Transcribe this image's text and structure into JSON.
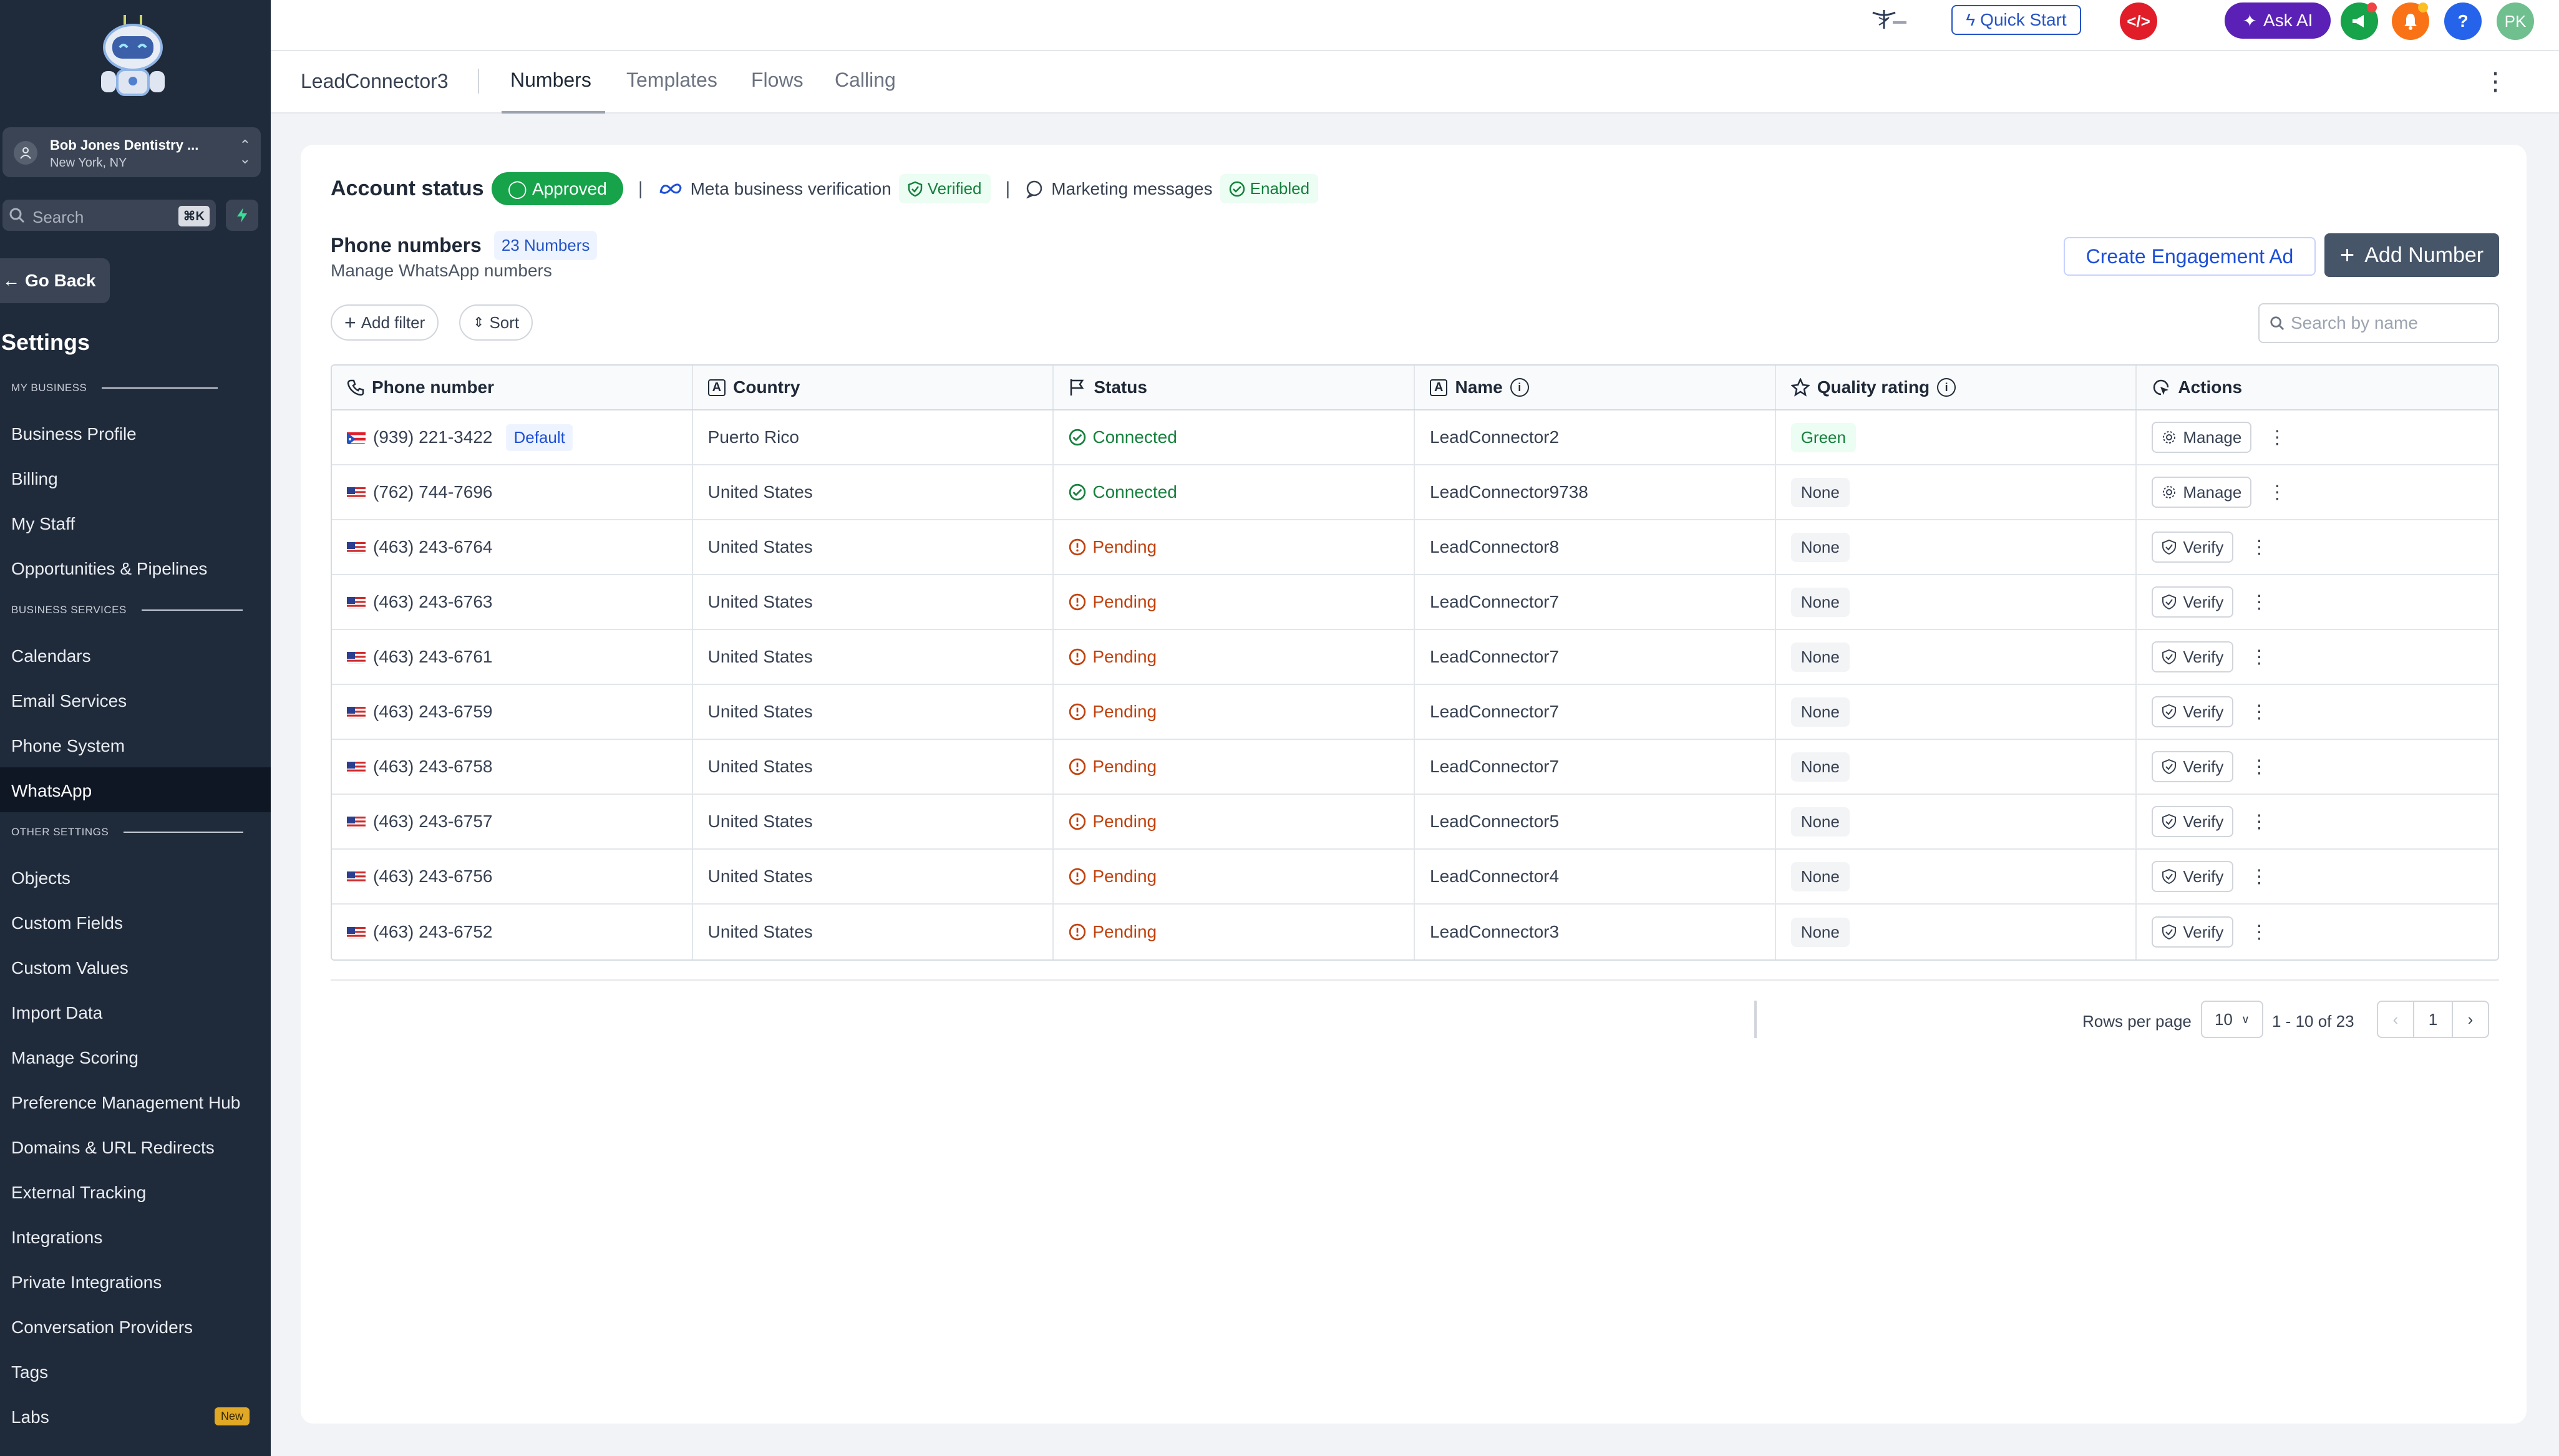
{
  "sidebar": {
    "account": {
      "name": "Bob Jones Dentistry ...",
      "location": "New York, NY"
    },
    "search": {
      "placeholder": "Search",
      "shortcut": "⌘K"
    },
    "go_back": "Go Back",
    "title": "Settings",
    "sections": {
      "my_business": "MY BUSINESS",
      "business_services": "BUSINESS SERVICES",
      "other_settings": "OTHER SETTINGS"
    },
    "items": {
      "business_profile": "Business Profile",
      "billing": "Billing",
      "my_staff": "My Staff",
      "opportunities": "Opportunities & Pipelines",
      "calendars": "Calendars",
      "email_services": "Email Services",
      "phone_system": "Phone System",
      "whatsapp": "WhatsApp",
      "objects": "Objects",
      "custom_fields": "Custom Fields",
      "custom_values": "Custom Values",
      "import_data": "Import Data",
      "manage_scoring": "Manage Scoring",
      "preference_hub": "Preference Management Hub",
      "domains": "Domains & URL Redirects",
      "external_tracking": "External Tracking",
      "integrations": "Integrations",
      "private_integrations": "Private Integrations",
      "conversation_providers": "Conversation Providers",
      "tags": "Tags",
      "labs": "Labs"
    },
    "labs_badge": "New"
  },
  "topbar": {
    "quick_start": "Quick Start",
    "ask_ai": "Ask AI",
    "help": "?",
    "avatar_initials": "PK"
  },
  "tabs": {
    "brand": "LeadConnector3",
    "items": [
      "Numbers",
      "Templates",
      "Flows",
      "Calling"
    ]
  },
  "status": {
    "account_status_label": "Account status",
    "account_status": "Approved",
    "meta_label": "Meta business verification",
    "meta_status": "Verified",
    "marketing_label": "Marketing messages",
    "marketing_status": "Enabled"
  },
  "phone_numbers": {
    "title": "Phone numbers",
    "count": "23 Numbers",
    "subtitle": "Manage WhatsApp numbers",
    "create_ad": "Create Engagement Ad",
    "add_number": "Add Number",
    "add_filter": "Add filter",
    "sort": "Sort",
    "search_placeholder": "Search by name"
  },
  "table": {
    "columns": [
      "Phone number",
      "Country",
      "Status",
      "Name",
      "Quality rating",
      "Actions"
    ],
    "default_label": "Default",
    "rows": [
      {
        "phone": "(939) 221-3422",
        "country": "Puerto Rico",
        "status": "Connected",
        "name": "LeadConnector2",
        "quality": "Green",
        "action": "Manage"
      },
      {
        "phone": "(762) 744-7696",
        "country": "United States",
        "status": "Connected",
        "name": "LeadConnector9738",
        "quality": "None",
        "action": "Manage"
      },
      {
        "phone": "(463) 243-6764",
        "country": "United States",
        "status": "Pending",
        "name": "LeadConnector8",
        "quality": "None",
        "action": "Verify"
      },
      {
        "phone": "(463) 243-6763",
        "country": "United States",
        "status": "Pending",
        "name": "LeadConnector7",
        "quality": "None",
        "action": "Verify"
      },
      {
        "phone": "(463) 243-6761",
        "country": "United States",
        "status": "Pending",
        "name": "LeadConnector7",
        "quality": "None",
        "action": "Verify"
      },
      {
        "phone": "(463) 243-6759",
        "country": "United States",
        "status": "Pending",
        "name": "LeadConnector7",
        "quality": "None",
        "action": "Verify"
      },
      {
        "phone": "(463) 243-6758",
        "country": "United States",
        "status": "Pending",
        "name": "LeadConnector7",
        "quality": "None",
        "action": "Verify"
      },
      {
        "phone": "(463) 243-6757",
        "country": "United States",
        "status": "Pending",
        "name": "LeadConnector5",
        "quality": "None",
        "action": "Verify"
      },
      {
        "phone": "(463) 243-6756",
        "country": "United States",
        "status": "Pending",
        "name": "LeadConnector4",
        "quality": "None",
        "action": "Verify"
      },
      {
        "phone": "(463) 243-6752",
        "country": "United States",
        "status": "Pending",
        "name": "LeadConnector3",
        "quality": "None",
        "action": "Verify"
      }
    ]
  },
  "pagination": {
    "rows_per_page_label": "Rows per page",
    "rows_per_page": "10",
    "range": "1 - 10 of 23",
    "page": "1"
  }
}
